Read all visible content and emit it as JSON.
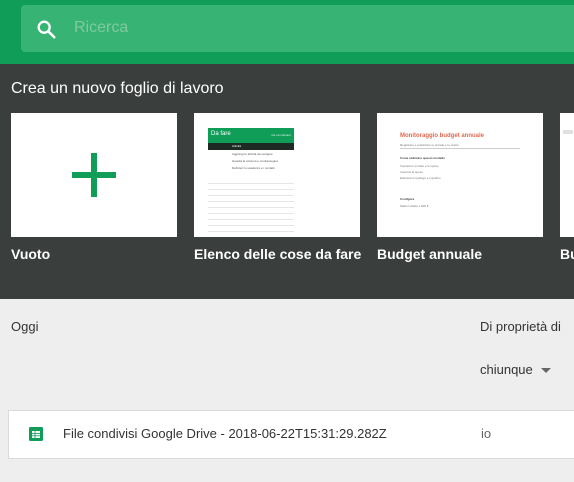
{
  "search": {
    "placeholder": "Ricerca",
    "icon": "search-icon"
  },
  "template_gallery": {
    "title": "Crea un nuovo foglio di lavoro",
    "templates": [
      {
        "label": "Vuoto"
      },
      {
        "label": "Elenco delle cose da fare",
        "thumb_title": "Da fare",
        "thumb_corner": "Da completare",
        "thumb_col_header": "Attività",
        "thumb_rows": [
          "Aggiungi le attività da svolgere",
          "Guarda la colonna e contrassegna",
          "Definisci lo scadenze e i contatti"
        ]
      },
      {
        "label": "Budget annuale",
        "thumb_title": "Monitoraggio budget annuale",
        "thumb_subtitle": "Registrare e analizzare le entrate e le uscite",
        "thumb_heading": "Come utilizzare questo modello",
        "thumb_lines": [
          "Imposta le entrate e le spese",
          "Inserisci le spese",
          "Esamina il riepilogo e il grafico"
        ],
        "thumb_footer": "Configura",
        "thumb_footer_value": "Saldo iniziale   1.000 €"
      },
      {
        "label": "Bu"
      }
    ]
  },
  "documents": {
    "section": "Oggi",
    "owner_header": "Di proprietà di",
    "owner_filter": "chiunque",
    "files": [
      {
        "name": "File condivisi Google Drive - 2018-06-22T15:31:29.282Z",
        "owner": "io",
        "icon": "spreadsheet-icon"
      }
    ]
  },
  "colors": {
    "brand": "#0f9d58",
    "gallery_bg": "#3a3f3d",
    "accent_red": "#e06a4e"
  }
}
